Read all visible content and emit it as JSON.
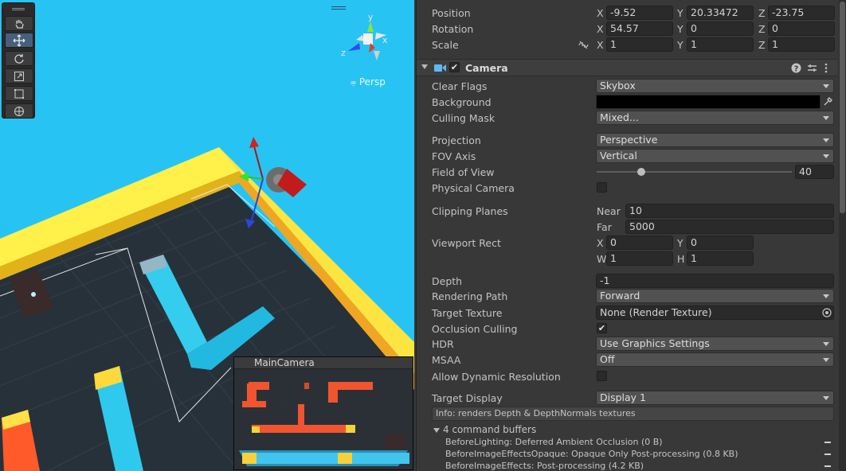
{
  "scene": {
    "persp_label": "Persp",
    "preview_title": "MainCamera",
    "axes": {
      "y": "y",
      "x": "x",
      "z": "z"
    }
  },
  "tools": [
    "hand-tool-icon",
    "move-tool-icon",
    "rotate-tool-icon",
    "scale-tool-icon",
    "rect-tool-icon",
    "transform-tool-icon"
  ],
  "transform": {
    "position": {
      "label": "Position",
      "x": "-9.52",
      "y": "20.33472",
      "z": "-23.75"
    },
    "rotation": {
      "label": "Rotation",
      "x": "54.57",
      "y": "0",
      "z": "0"
    },
    "scale": {
      "label": "Scale",
      "x": "1",
      "y": "1",
      "z": "1"
    }
  },
  "axis_labels": {
    "x": "X",
    "y": "Y",
    "z": "Z",
    "w": "W",
    "h": "H"
  },
  "camera": {
    "title": "Camera",
    "clear_flags": {
      "label": "Clear Flags",
      "value": "Skybox"
    },
    "background": {
      "label": "Background",
      "color": "#000000"
    },
    "culling_mask": {
      "label": "Culling Mask",
      "value": "Mixed..."
    },
    "projection": {
      "label": "Projection",
      "value": "Perspective"
    },
    "fov_axis": {
      "label": "FOV Axis",
      "value": "Vertical"
    },
    "field_of_view": {
      "label": "Field of View",
      "value": "40"
    },
    "physical_camera": {
      "label": "Physical Camera",
      "checked": false
    },
    "clipping_planes": {
      "label": "Clipping Planes",
      "near_label": "Near",
      "near": "10",
      "far_label": "Far",
      "far": "5000"
    },
    "viewport_rect": {
      "label": "Viewport Rect",
      "x": "0",
      "y": "0",
      "w": "1",
      "h": "1"
    },
    "depth": {
      "label": "Depth",
      "value": "-1"
    },
    "rendering_path": {
      "label": "Rendering Path",
      "value": "Forward"
    },
    "target_texture": {
      "label": "Target Texture",
      "value": "None (Render Texture)"
    },
    "occlusion_culling": {
      "label": "Occlusion Culling",
      "checked": true,
      "mark": "✔"
    },
    "hdr": {
      "label": "HDR",
      "value": "Use Graphics Settings"
    },
    "msaa": {
      "label": "MSAA",
      "value": "Off"
    },
    "allow_dynamic_resolution": {
      "label": "Allow Dynamic Resolution",
      "checked": false
    },
    "target_display": {
      "label": "Target Display",
      "value": "Display 1"
    },
    "info": "Info: renders Depth & DepthNormals textures",
    "command_buffers": {
      "header": "4 command buffers",
      "items": [
        "BeforeLighting: Deferred Ambient Occlusion (0 B)",
        "BeforeImageEffectsOpaque: Opaque Only Post-processing (0.8 KB)",
        "BeforeImageEffects: Post-processing (4.2 KB)"
      ]
    }
  }
}
